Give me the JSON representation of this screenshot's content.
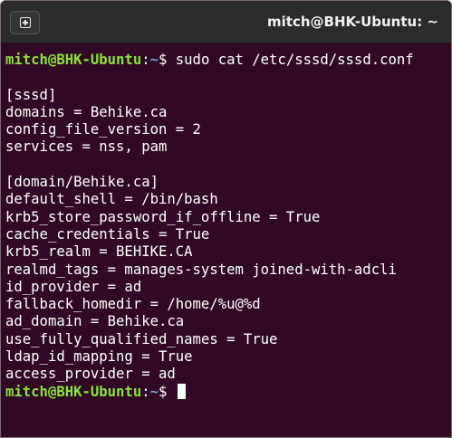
{
  "window": {
    "title": "mitch@BHK-Ubuntu: ~",
    "new_tab_icon": "new-tab-icon"
  },
  "prompt": {
    "user_host": "mitch@BHK-Ubuntu",
    "sep": ":",
    "path": "~",
    "symbol": "$",
    "command": " sudo cat /etc/sssd/sssd.conf"
  },
  "output": [
    "",
    "[sssd]",
    "domains = Behike.ca",
    "config_file_version = 2",
    "services = nss, pam",
    "",
    "[domain/Behike.ca]",
    "default_shell = /bin/bash",
    "krb5_store_password_if_offline = True",
    "cache_credentials = True",
    "krb5_realm = BEHIKE.CA",
    "realmd_tags = manages-system joined-with-adcli",
    "id_provider = ad",
    "fallback_homedir = /home/%u@%d",
    "ad_domain = Behike.ca",
    "use_fully_qualified_names = True",
    "ldap_id_mapping = True",
    "access_provider = ad"
  ],
  "final_prompt": {
    "user_host": "mitch@BHK-Ubuntu",
    "sep": ":",
    "path": "~",
    "symbol": "$ "
  },
  "colors": {
    "terminal_bg": "#300a24",
    "titlebar_bg": "#2b2b2b",
    "prompt_user": "#8ae234",
    "prompt_path": "#729fcf",
    "text": "#ffffff"
  }
}
